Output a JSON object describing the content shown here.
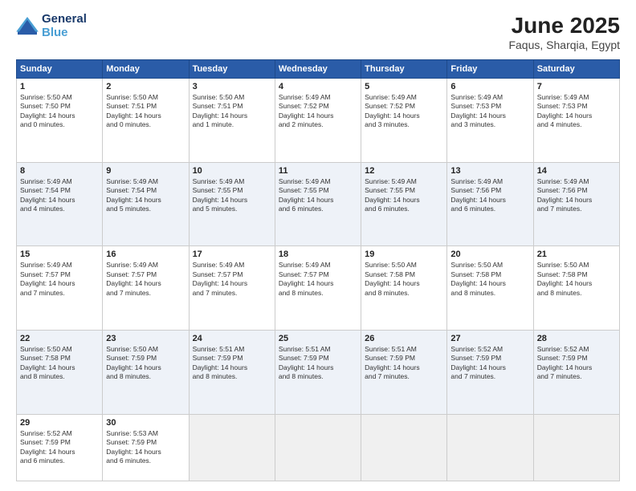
{
  "logo": {
    "line1": "General",
    "line2": "Blue"
  },
  "title": "June 2025",
  "subtitle": "Faqus, Sharqia, Egypt",
  "days_of_week": [
    "Sunday",
    "Monday",
    "Tuesday",
    "Wednesday",
    "Thursday",
    "Friday",
    "Saturday"
  ],
  "weeks": [
    [
      {
        "num": "1",
        "sunrise": "5:50 AM",
        "sunset": "7:50 PM",
        "daylight": "14 hours and 0 minutes."
      },
      {
        "num": "2",
        "sunrise": "5:50 AM",
        "sunset": "7:51 PM",
        "daylight": "14 hours and 0 minutes."
      },
      {
        "num": "3",
        "sunrise": "5:50 AM",
        "sunset": "7:51 PM",
        "daylight": "14 hours and 1 minute."
      },
      {
        "num": "4",
        "sunrise": "5:49 AM",
        "sunset": "7:52 PM",
        "daylight": "14 hours and 2 minutes."
      },
      {
        "num": "5",
        "sunrise": "5:49 AM",
        "sunset": "7:52 PM",
        "daylight": "14 hours and 3 minutes."
      },
      {
        "num": "6",
        "sunrise": "5:49 AM",
        "sunset": "7:53 PM",
        "daylight": "14 hours and 3 minutes."
      },
      {
        "num": "7",
        "sunrise": "5:49 AM",
        "sunset": "7:53 PM",
        "daylight": "14 hours and 4 minutes."
      }
    ],
    [
      {
        "num": "8",
        "sunrise": "5:49 AM",
        "sunset": "7:54 PM",
        "daylight": "14 hours and 4 minutes."
      },
      {
        "num": "9",
        "sunrise": "5:49 AM",
        "sunset": "7:54 PM",
        "daylight": "14 hours and 5 minutes."
      },
      {
        "num": "10",
        "sunrise": "5:49 AM",
        "sunset": "7:55 PM",
        "daylight": "14 hours and 5 minutes."
      },
      {
        "num": "11",
        "sunrise": "5:49 AM",
        "sunset": "7:55 PM",
        "daylight": "14 hours and 6 minutes."
      },
      {
        "num": "12",
        "sunrise": "5:49 AM",
        "sunset": "7:55 PM",
        "daylight": "14 hours and 6 minutes."
      },
      {
        "num": "13",
        "sunrise": "5:49 AM",
        "sunset": "7:56 PM",
        "daylight": "14 hours and 6 minutes."
      },
      {
        "num": "14",
        "sunrise": "5:49 AM",
        "sunset": "7:56 PM",
        "daylight": "14 hours and 7 minutes."
      }
    ],
    [
      {
        "num": "15",
        "sunrise": "5:49 AM",
        "sunset": "7:57 PM",
        "daylight": "14 hours and 7 minutes."
      },
      {
        "num": "16",
        "sunrise": "5:49 AM",
        "sunset": "7:57 PM",
        "daylight": "14 hours and 7 minutes."
      },
      {
        "num": "17",
        "sunrise": "5:49 AM",
        "sunset": "7:57 PM",
        "daylight": "14 hours and 7 minutes."
      },
      {
        "num": "18",
        "sunrise": "5:49 AM",
        "sunset": "7:57 PM",
        "daylight": "14 hours and 8 minutes."
      },
      {
        "num": "19",
        "sunrise": "5:50 AM",
        "sunset": "7:58 PM",
        "daylight": "14 hours and 8 minutes."
      },
      {
        "num": "20",
        "sunrise": "5:50 AM",
        "sunset": "7:58 PM",
        "daylight": "14 hours and 8 minutes."
      },
      {
        "num": "21",
        "sunrise": "5:50 AM",
        "sunset": "7:58 PM",
        "daylight": "14 hours and 8 minutes."
      }
    ],
    [
      {
        "num": "22",
        "sunrise": "5:50 AM",
        "sunset": "7:58 PM",
        "daylight": "14 hours and 8 minutes."
      },
      {
        "num": "23",
        "sunrise": "5:50 AM",
        "sunset": "7:59 PM",
        "daylight": "14 hours and 8 minutes."
      },
      {
        "num": "24",
        "sunrise": "5:51 AM",
        "sunset": "7:59 PM",
        "daylight": "14 hours and 8 minutes."
      },
      {
        "num": "25",
        "sunrise": "5:51 AM",
        "sunset": "7:59 PM",
        "daylight": "14 hours and 8 minutes."
      },
      {
        "num": "26",
        "sunrise": "5:51 AM",
        "sunset": "7:59 PM",
        "daylight": "14 hours and 7 minutes."
      },
      {
        "num": "27",
        "sunrise": "5:52 AM",
        "sunset": "7:59 PM",
        "daylight": "14 hours and 7 minutes."
      },
      {
        "num": "28",
        "sunrise": "5:52 AM",
        "sunset": "7:59 PM",
        "daylight": "14 hours and 7 minutes."
      }
    ],
    [
      {
        "num": "29",
        "sunrise": "5:52 AM",
        "sunset": "7:59 PM",
        "daylight": "14 hours and 6 minutes."
      },
      {
        "num": "30",
        "sunrise": "5:53 AM",
        "sunset": "7:59 PM",
        "daylight": "14 hours and 6 minutes."
      },
      null,
      null,
      null,
      null,
      null
    ]
  ]
}
